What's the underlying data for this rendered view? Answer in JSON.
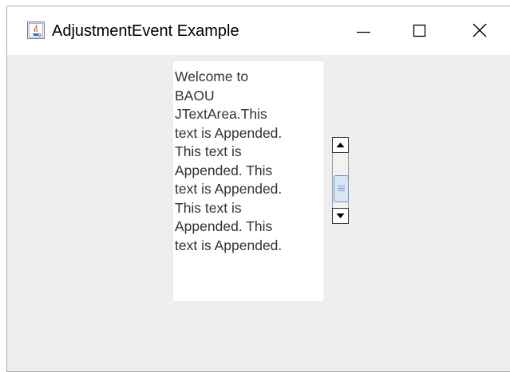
{
  "window": {
    "title": "AdjustmentEvent Example",
    "icons": {
      "app": "java-cup-icon",
      "minimize": "minimize-icon",
      "maximize": "maximize-icon",
      "close": "close-icon"
    }
  },
  "text_area": {
    "lines": [
      "Welcome to",
      "BAOU",
      "JTextArea.This",
      "text is Appended.",
      "This text is",
      "Appended. This",
      "text is Appended.",
      "This text is",
      "Appended. This",
      "text is Appended."
    ]
  },
  "scrollbar": {
    "orientation": "vertical",
    "icons": {
      "up": "arrow-up-icon",
      "down": "arrow-down-icon",
      "thumb": "scroll-thumb"
    }
  },
  "colors": {
    "window_bg": "#eeeeee",
    "titlebar_bg": "#ffffff",
    "thumb_fill": "#dbe6f5",
    "thumb_border": "#6a8fc4"
  }
}
